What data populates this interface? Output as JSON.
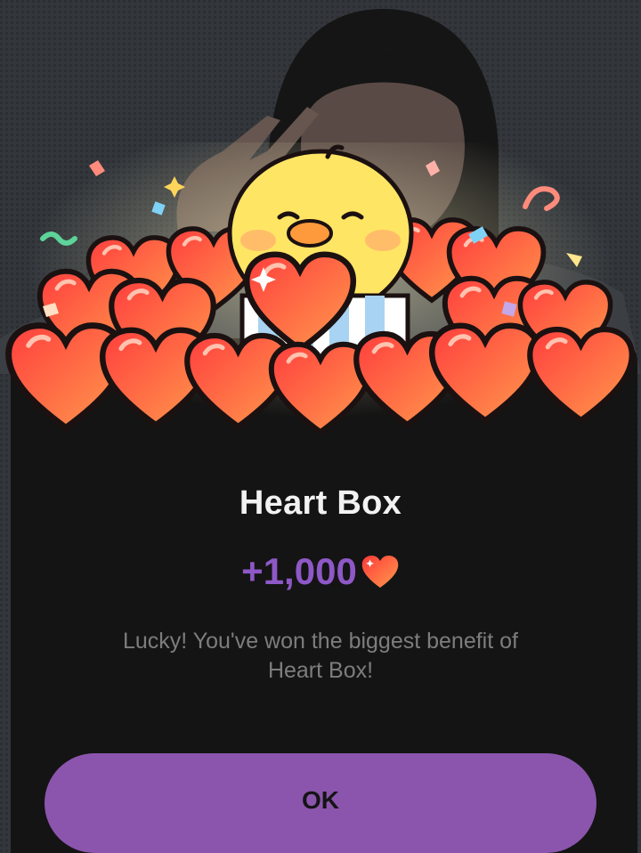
{
  "dialog": {
    "title": "Heart Box",
    "reward_amount": "+1,000",
    "reward_icon": "heart-icon",
    "message": "Lucky! You've won the biggest benefit of Heart Box!",
    "ok_label": "OK"
  },
  "colors": {
    "accent": "#8b55ad",
    "reward_text": "#8e58c6",
    "panel": "#141414",
    "heart": "#f2553f"
  }
}
